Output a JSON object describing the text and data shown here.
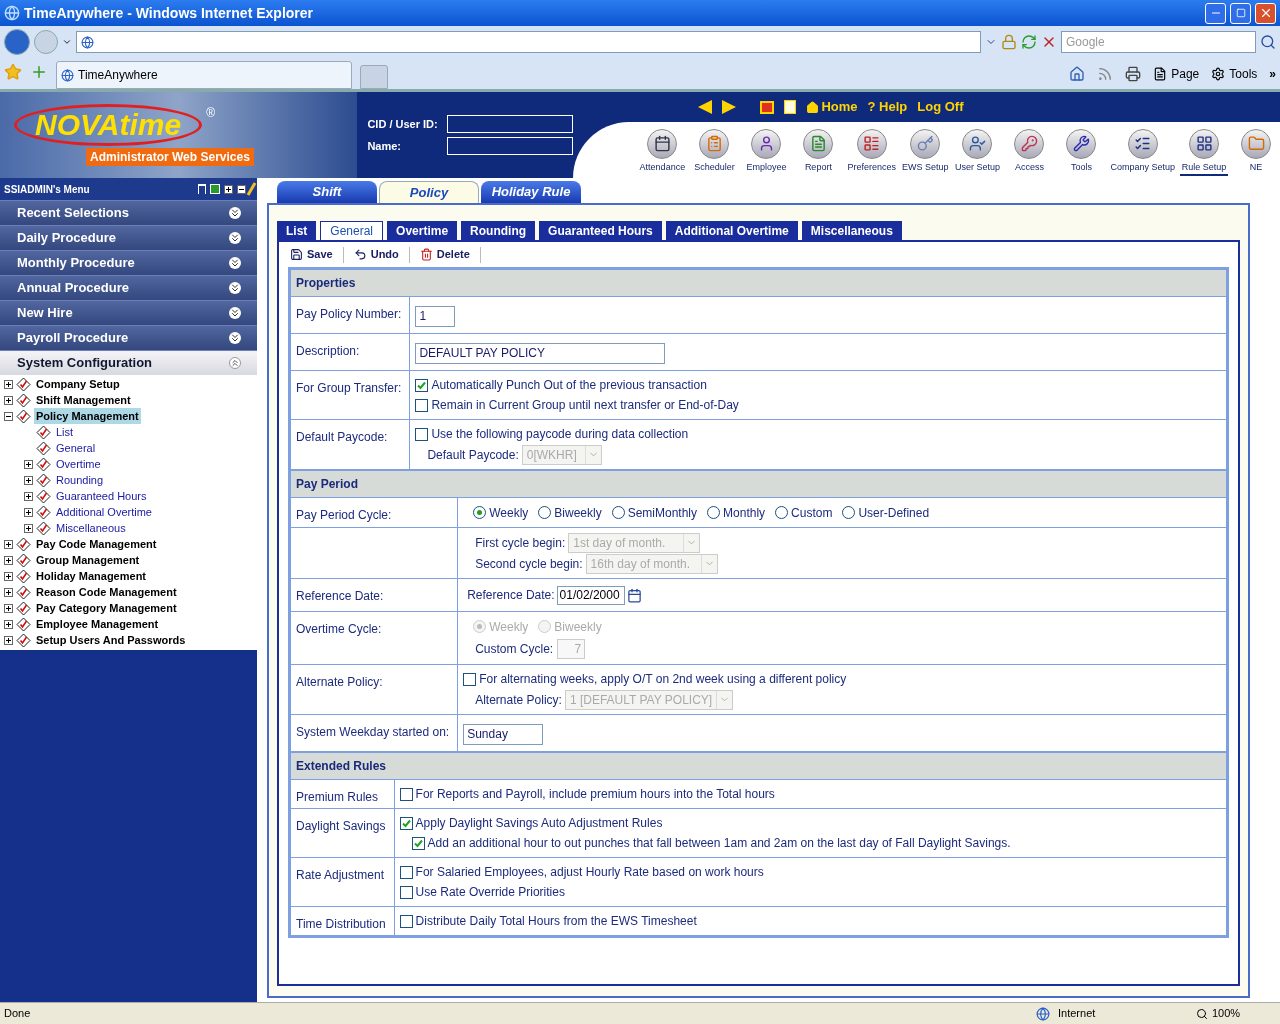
{
  "browser": {
    "title": "TimeAnywhere - Windows Internet Explorer",
    "search_placeholder": "Google",
    "tab_title": "TimeAnywhere",
    "commands": [
      "Page",
      "Tools"
    ],
    "more": "»"
  },
  "header": {
    "logo": "NOVAtime",
    "logo_mark": "®",
    "logo_sub": "Administrator Web Services",
    "fields": [
      {
        "label": "CID / User ID:"
      },
      {
        "label": "Name:"
      }
    ],
    "links": [
      {
        "kind": "home",
        "label": "Home"
      },
      {
        "kind": "help",
        "glyph": "?",
        "label": "Help"
      },
      {
        "kind": "plain",
        "label": "Log Off"
      }
    ],
    "modules": [
      {
        "label": "Attendance",
        "selected": false
      },
      {
        "label": "Scheduler",
        "selected": false
      },
      {
        "label": "Employee",
        "selected": false
      },
      {
        "label": "Report",
        "selected": false
      },
      {
        "label": "Preferences",
        "selected": false
      },
      {
        "label": "EWS Setup",
        "selected": false
      },
      {
        "label": "User Setup",
        "selected": false
      },
      {
        "label": "Access",
        "selected": false
      },
      {
        "label": "Tools",
        "selected": false
      },
      {
        "label": "Company Setup",
        "selected": false
      },
      {
        "label": "Rule Setup",
        "selected": true
      },
      {
        "label": "NE",
        "selected": false
      }
    ]
  },
  "sidebar": {
    "title": "SSIADMIN's Menu",
    "sections": [
      {
        "label": "Recent Selections",
        "expanded": false
      },
      {
        "label": "Daily Procedure",
        "expanded": false
      },
      {
        "label": "Monthly Procedure",
        "expanded": false
      },
      {
        "label": "Annual Procedure",
        "expanded": false
      },
      {
        "label": "New Hire",
        "expanded": false
      },
      {
        "label": "Payroll Procedure",
        "expanded": false
      },
      {
        "label": "System Configuration",
        "expanded": true
      }
    ],
    "tree": [
      {
        "label": "Company Setup",
        "expanded": false,
        "selected": false
      },
      {
        "label": "Shift Management",
        "expanded": false,
        "selected": false
      },
      {
        "label": "Policy Management",
        "expanded": true,
        "selected": true,
        "children": [
          {
            "label": "List",
            "selected": false
          },
          {
            "label": "General",
            "selected": false
          },
          {
            "label": "Overtime",
            "expanded": false,
            "selected": false
          },
          {
            "label": "Rounding",
            "expanded": false,
            "selected": false
          },
          {
            "label": "Guaranteed Hours",
            "expanded": false,
            "selected": false
          },
          {
            "label": "Additional Overtime",
            "expanded": false,
            "selected": false
          },
          {
            "label": "Miscellaneous",
            "expanded": false,
            "selected": false
          }
        ]
      },
      {
        "label": "Pay Code Management",
        "expanded": false,
        "selected": false
      },
      {
        "label": "Group Management",
        "expanded": false,
        "selected": false
      },
      {
        "label": "Holiday Management",
        "expanded": false,
        "selected": false
      },
      {
        "label": "Reason Code Management",
        "expanded": false,
        "selected": false
      },
      {
        "label": "Pay Category Management",
        "expanded": false,
        "selected": false
      },
      {
        "label": "Employee Management",
        "expanded": false,
        "selected": false
      },
      {
        "label": "Setup Users And Passwords",
        "expanded": false,
        "selected": false
      }
    ]
  },
  "main": {
    "tabs": [
      {
        "label": "Shift",
        "selected": false
      },
      {
        "label": "Policy",
        "selected": true
      },
      {
        "label": "Holiday Rule",
        "selected": false
      }
    ],
    "sub_tabs": [
      {
        "label": "List",
        "selected": false
      },
      {
        "label": "General",
        "selected": true
      },
      {
        "label": "Overtime",
        "selected": false
      },
      {
        "label": "Rounding",
        "selected": false
      },
      {
        "label": "Guaranteed Hours",
        "selected": false
      },
      {
        "label": "Additional Overtime",
        "selected": false
      },
      {
        "label": "Miscellaneous",
        "selected": false
      }
    ],
    "actions": [
      {
        "kind": "save",
        "label": "Save"
      },
      {
        "kind": "undo",
        "label": "Undo"
      },
      {
        "kind": "delete",
        "label": "Delete"
      }
    ],
    "sections": [
      {
        "title": "Properties",
        "rows": [
          {
            "label": "Pay Policy Number:",
            "controls": [
              {
                "kind": "input",
                "value": "1"
              }
            ]
          },
          {
            "label": "Description:",
            "controls": [
              {
                "kind": "input",
                "value": "DEFAULT PAY POLICY"
              }
            ]
          },
          {
            "label": "For Group Transfer:",
            "controls": [
              {
                "kind": "checkbox",
                "label": "Automatically Punch Out of the previous transaction",
                "checked": true
              },
              {
                "kind": "checkbox",
                "label": "Remain in Current Group until next transfer or End-of-Day",
                "checked": false
              }
            ]
          },
          {
            "label": "Default Paycode:",
            "controls": [
              {
                "kind": "checkbox",
                "label": "Use the following paycode during data collection",
                "checked": false
              },
              {
                "kind": "select",
                "label": "Default Paycode:",
                "value": "0[WKHR]",
                "disabled": true
              }
            ]
          }
        ]
      },
      {
        "title": "Pay Period",
        "rows": [
          {
            "label": "Pay Period Cycle:",
            "controls": [
              {
                "kind": "radios",
                "disabled": false,
                "options": [
                  {
                    "label": "Weekly",
                    "selected": true
                  },
                  {
                    "label": "Biweekly",
                    "selected": false
                  },
                  {
                    "label": "SemiMonthly",
                    "selected": false
                  },
                  {
                    "label": "Monthly",
                    "selected": false
                  },
                  {
                    "label": "Custom",
                    "selected": false
                  },
                  {
                    "label": "User-Defined",
                    "selected": false
                  }
                ]
              }
            ]
          },
          {
            "controls": [
              {
                "kind": "select",
                "label": "First cycle begin:",
                "value": "1st day of month.",
                "disabled": true
              },
              {
                "kind": "select",
                "label": "Second cycle begin:",
                "value": "16th day of month.",
                "disabled": true
              }
            ]
          },
          {
            "label": "Reference Date:",
            "controls": [
              {
                "kind": "date",
                "label": "Reference Date:",
                "value": "01/02/2000"
              }
            ]
          },
          {
            "label": "Overtime Cycle:",
            "controls": [
              {
                "kind": "radios",
                "disabled": true,
                "options": [
                  {
                    "label": "Weekly",
                    "selected": true
                  },
                  {
                    "label": "Biweekly",
                    "selected": false
                  }
                ]
              },
              {
                "kind": "number",
                "label": "Custom Cycle:",
                "value": "7",
                "disabled": true
              }
            ]
          },
          {
            "label": "Alternate Policy:",
            "controls": [
              {
                "kind": "checkbox",
                "label": "For alternating weeks, apply O/T on 2nd week using a different policy",
                "checked": false
              },
              {
                "kind": "select",
                "label": "Alternate Policy:",
                "value": "1 [DEFAULT PAY POLICY]",
                "disabled": true
              }
            ]
          },
          {
            "label": "System Weekday started on:",
            "controls": [
              {
                "kind": "input",
                "value": "Sunday"
              }
            ]
          }
        ]
      },
      {
        "title": "Extended Rules",
        "rows": [
          {
            "label": "Premium Rules",
            "controls": [
              {
                "kind": "checkbox",
                "label": "For Reports and Payroll, include premium hours into the Total hours",
                "checked": false
              }
            ]
          },
          {
            "label": "Daylight Savings",
            "controls": [
              {
                "kind": "checkbox",
                "label": "Apply Daylight Savings Auto Adjustment Rules",
                "checked": true
              },
              {
                "kind": "subcheckbox",
                "label": "Add an additional hour to out punches that fall between 1am and 2am on the last day of Fall Daylight Savings.",
                "checked": true
              }
            ]
          },
          {
            "label": "Rate Adjustment",
            "controls": [
              {
                "kind": "checkbox",
                "label": "For Salaried Employees, adjust Hourly Rate based on work hours",
                "checked": false
              },
              {
                "kind": "checkbox",
                "label": "Use Rate Override Priorities",
                "checked": false
              }
            ]
          },
          {
            "label": "Time Distribution",
            "controls": [
              {
                "kind": "checkbox",
                "label": "Distribute Daily Total Hours from the EWS Timesheet",
                "checked": false
              }
            ]
          }
        ]
      }
    ]
  },
  "status_bar": {
    "text": "Done",
    "zone": "Internet",
    "zoom": "100%"
  }
}
